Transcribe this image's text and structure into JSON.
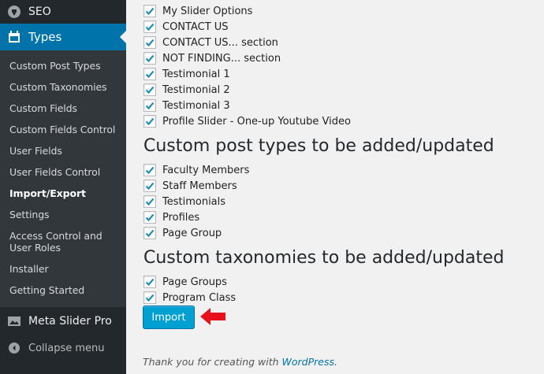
{
  "sidebar": {
    "seo_label": "SEO",
    "types_label": "Types",
    "submenu": [
      {
        "label": "Custom Post Types"
      },
      {
        "label": "Custom Taxonomies"
      },
      {
        "label": "Custom Fields"
      },
      {
        "label": "Custom Fields Control"
      },
      {
        "label": "User Fields"
      },
      {
        "label": "User Fields Control"
      },
      {
        "label": "Import/Export",
        "current": true
      },
      {
        "label": "Settings"
      },
      {
        "label": "Access Control and User Roles"
      },
      {
        "label": "Installer"
      },
      {
        "label": "Getting Started"
      }
    ],
    "metaslider_label": "Meta Slider Pro",
    "collapse_label": "Collapse menu"
  },
  "main": {
    "groups_items": [
      {
        "label": "My Slider Options",
        "checked": true
      },
      {
        "label": "CONTACT US",
        "checked": true
      },
      {
        "label": "CONTACT US... section",
        "checked": true
      },
      {
        "label": "NOT FINDING... section",
        "checked": true
      },
      {
        "label": "Testimonial 1",
        "checked": true
      },
      {
        "label": "Testimonial 2",
        "checked": true
      },
      {
        "label": "Testimonial 3",
        "checked": true
      },
      {
        "label": "Profile Slider - One-up Youtube Video",
        "checked": true
      }
    ],
    "post_types_heading": "Custom post types to be added/updated",
    "post_types": [
      {
        "label": "Faculty Members",
        "checked": true
      },
      {
        "label": "Staff Members",
        "checked": true
      },
      {
        "label": "Testimonials",
        "checked": true
      },
      {
        "label": "Profiles",
        "checked": true
      },
      {
        "label": "Page Group",
        "checked": true
      }
    ],
    "taxonomies_heading": "Custom taxonomies to be added/updated",
    "taxonomies": [
      {
        "label": "Page Groups",
        "checked": true
      },
      {
        "label": "Program Class",
        "checked": true
      }
    ],
    "import_button": "Import"
  },
  "footer": {
    "text": "Thank you for creating with ",
    "link": "WordPress",
    "end": "."
  },
  "colors": {
    "sidebar_bg": "#23282d",
    "submenu_bg": "#32373c",
    "accent": "#0073aa",
    "button": "#00a0d2",
    "checkmark": "#1e8cbe",
    "arrow": "#e8101a"
  }
}
